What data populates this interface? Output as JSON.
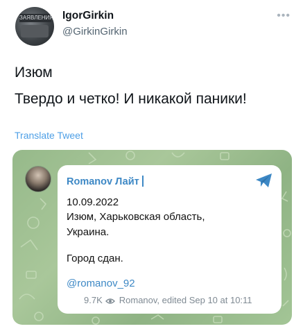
{
  "tweet": {
    "display_name": "IgorGirkin",
    "handle": "@GirkinGirkin",
    "more_icon": "more-icon",
    "avatar_caption": "ЗАЯВЛЕНИЯ",
    "text_line1": "Изюм",
    "text_line2": "Твердо и четко! И никакой паники!",
    "translate_label": "Translate Tweet"
  },
  "telegram_post": {
    "channel_name": "Romanov Лайт",
    "date": "10.09.2022",
    "location_line1": "Изюм, Харьковская область,",
    "location_line2": "Украина.",
    "message": "Город сдан.",
    "channel_link": "@romanov_92",
    "views": "9.7K",
    "author_edited": "Romanov, edited",
    "timestamp": "Sep 10 at 10:11",
    "share_icon": "telegram-send-icon",
    "colors": {
      "link": "#3d88c5",
      "card_background": "#9cbe8f"
    }
  }
}
